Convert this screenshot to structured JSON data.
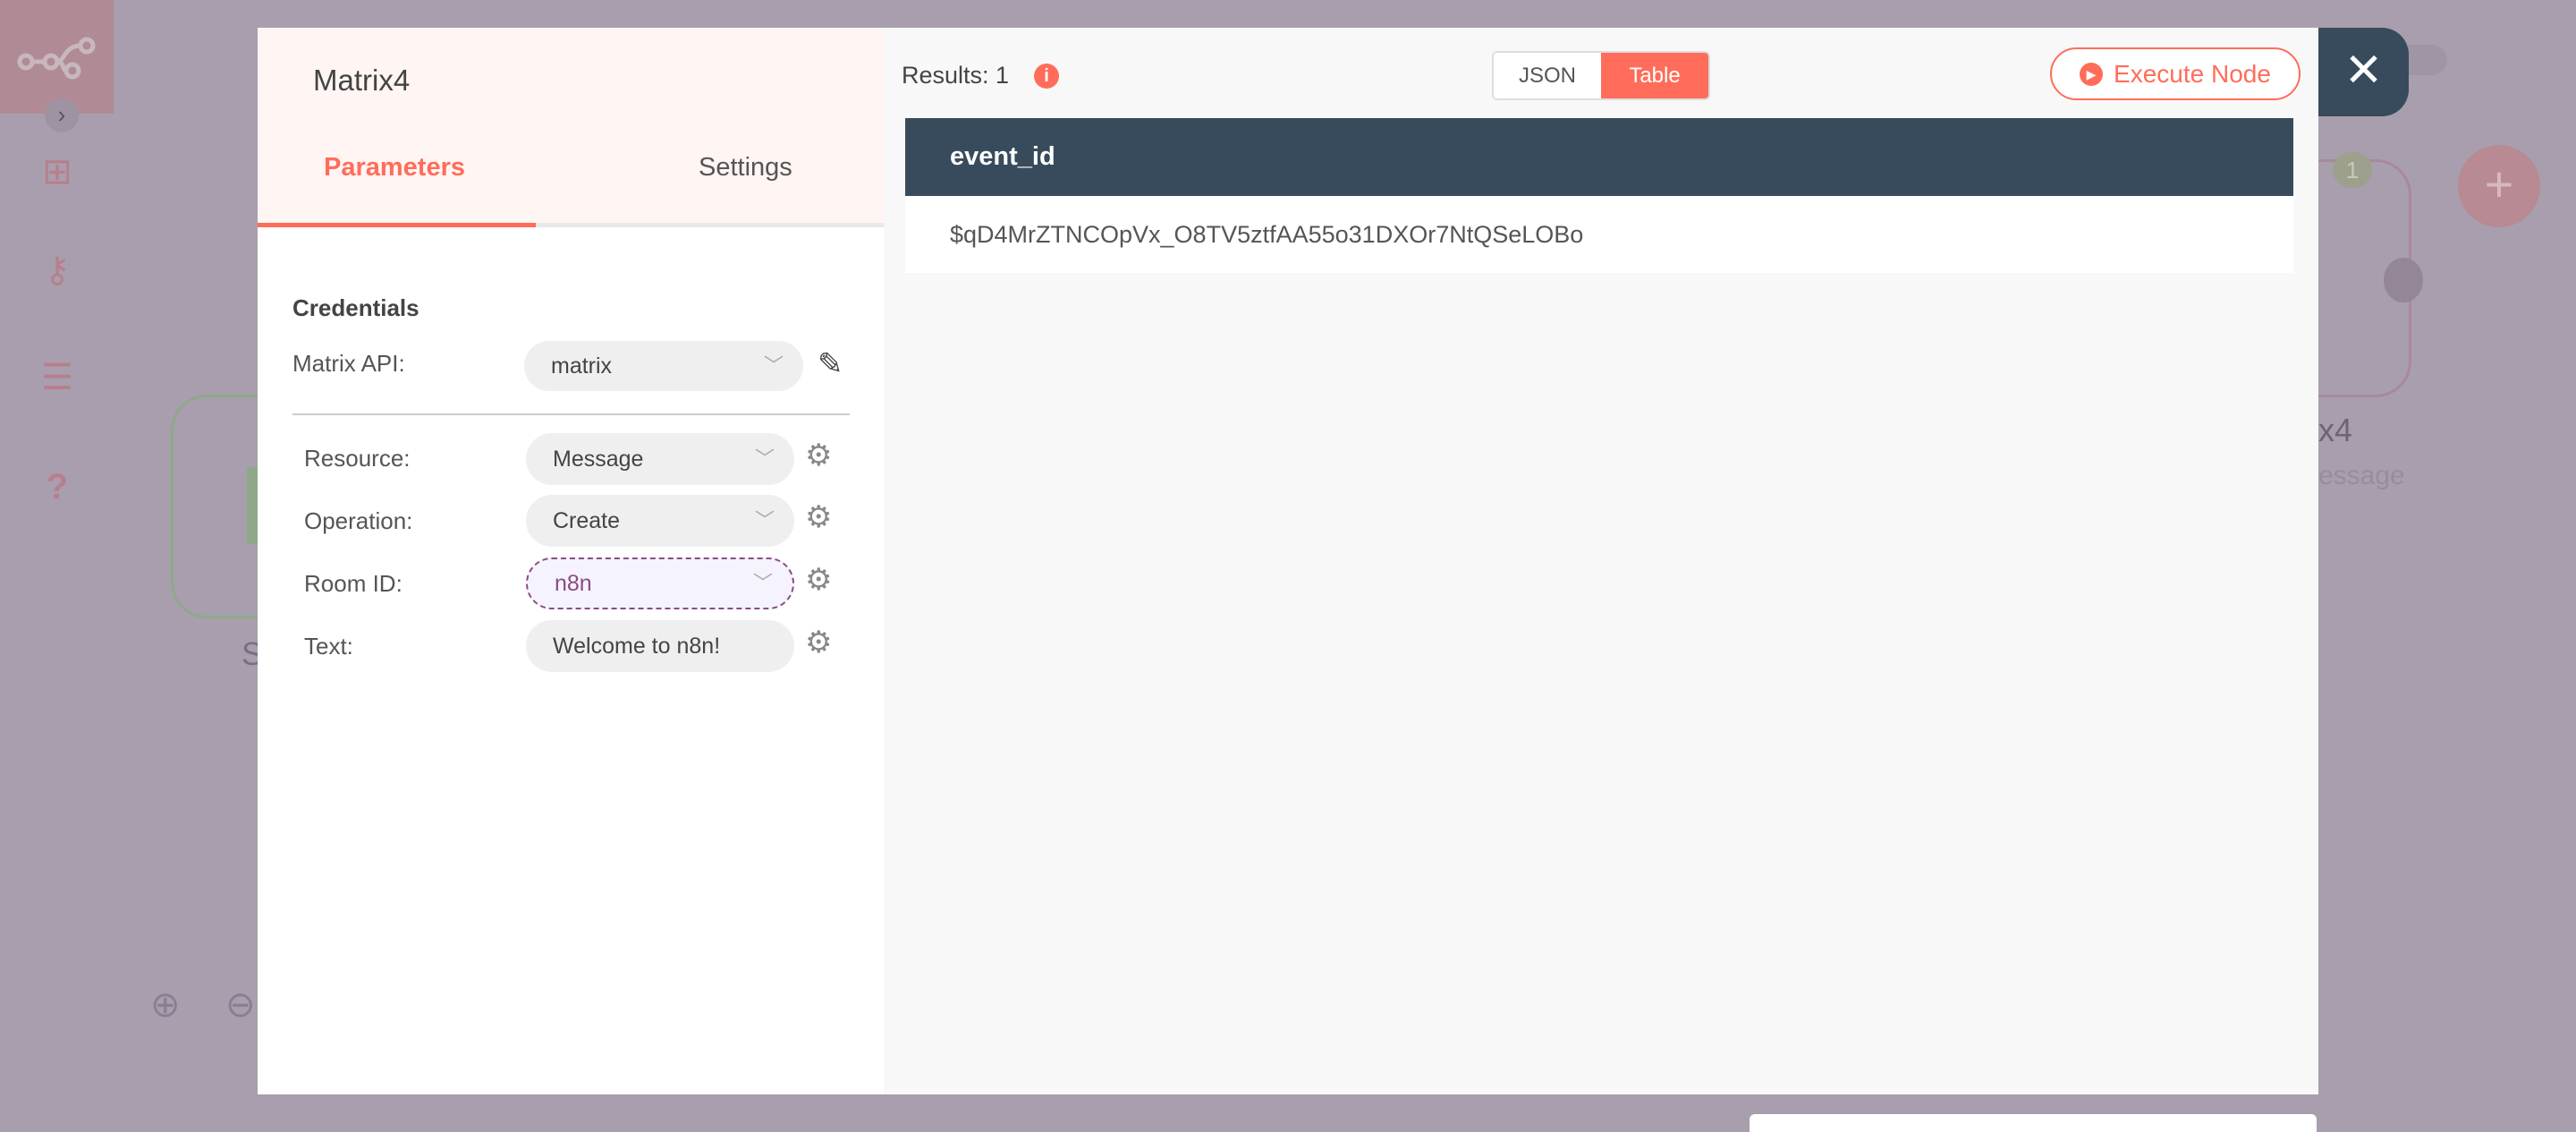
{
  "node": {
    "title": "Matrix4",
    "tabs": [
      "Parameters",
      "Settings"
    ]
  },
  "credentials": {
    "heading": "Credentials",
    "label": "Matrix API:",
    "value": "matrix"
  },
  "params": [
    {
      "label": "Resource:",
      "value": "Message"
    },
    {
      "label": "Operation:",
      "value": "Create"
    },
    {
      "label": "Room ID:",
      "value": "n8n"
    },
    {
      "label": "Text:",
      "value": "Welcome to n8n!"
    }
  ],
  "results": {
    "label": "Results: 1",
    "views": [
      "JSON",
      "Table"
    ],
    "active_view": "Table",
    "execute_label": "Execute Node"
  },
  "table": {
    "columns": [
      "event_id"
    ],
    "rows": [
      [
        "$qD4MrZTNCOpVx_O8TV5ztfAA55o31DXOr7NtQSeLOBo"
      ]
    ]
  },
  "background": {
    "right_node_label": "x4",
    "right_node_sub": "essage",
    "left_node_label": "S",
    "badge": "1"
  },
  "colors": {
    "accent": "#ff6d5a",
    "dark": "#374b5c",
    "roomid": "#8a4b86"
  }
}
